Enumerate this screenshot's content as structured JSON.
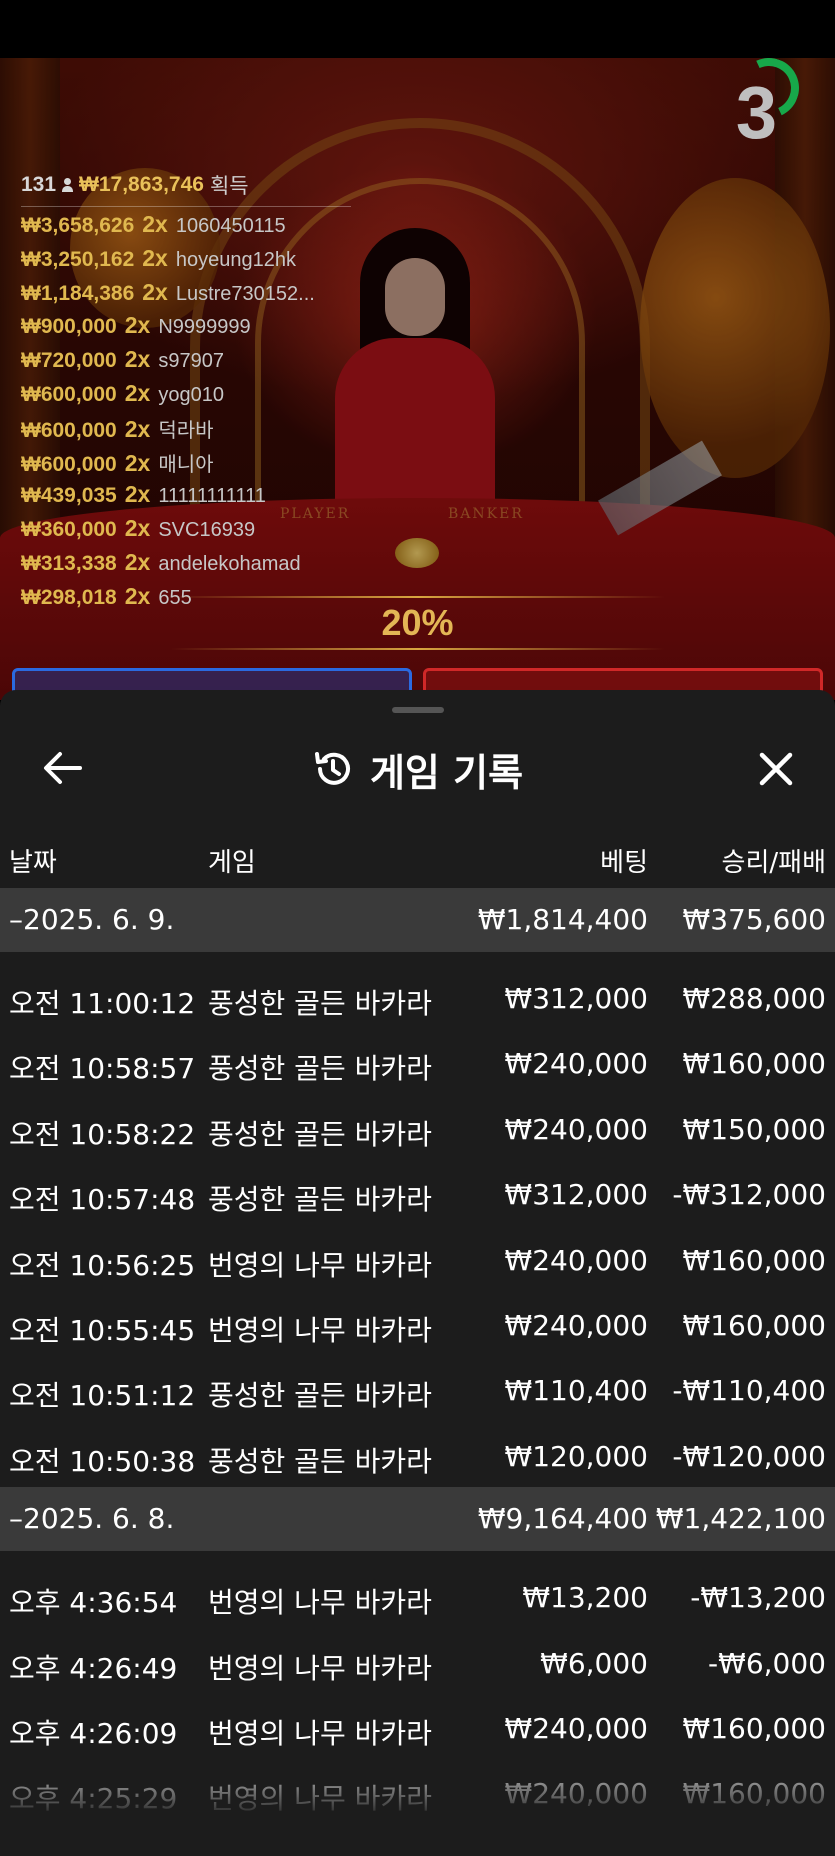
{
  "live_game": {
    "round_counter": "3",
    "winners_header": {
      "players": "131",
      "total": "₩17,863,746",
      "label": "획득"
    },
    "winners": [
      {
        "amount": "₩3,658,626",
        "multiplier": "2x",
        "name": "1060450115"
      },
      {
        "amount": "₩3,250,162",
        "multiplier": "2x",
        "name": "hoyeung12hk"
      },
      {
        "amount": "₩1,184,386",
        "multiplier": "2x",
        "name": "Lustre730152..."
      },
      {
        "amount": "₩900,000",
        "multiplier": "2x",
        "name": "N9999999"
      },
      {
        "amount": "₩720,000",
        "multiplier": "2x",
        "name": "s97907"
      },
      {
        "amount": "₩600,000",
        "multiplier": "2x",
        "name": "yog010"
      },
      {
        "amount": "₩600,000",
        "multiplier": "2x",
        "name": "덕라바"
      },
      {
        "amount": "₩600,000",
        "multiplier": "2x",
        "name": "매니아"
      },
      {
        "amount": "₩439,035",
        "multiplier": "2x",
        "name": "11111111111"
      },
      {
        "amount": "₩360,000",
        "multiplier": "2x",
        "name": "SVC16939"
      },
      {
        "amount": "₩313,338",
        "multiplier": "2x",
        "name": "andelekohamad"
      },
      {
        "amount": "₩298,018",
        "multiplier": "2x",
        "name": "655"
      }
    ],
    "table_labels": {
      "player": "PLAYER",
      "banker": "BANKER"
    },
    "percentage": "20%"
  },
  "history": {
    "title": "게임 기록",
    "columns": {
      "date": "날짜",
      "game": "게임",
      "bet": "베팅",
      "win_loss": "승리/패배"
    },
    "groups": [
      {
        "date": "–2025. 6. 9.",
        "total_bet": "₩1,814,400",
        "total_result": "₩375,600",
        "rows": [
          {
            "time": "오전 11:00:12",
            "game": "풍성한 골든 바카라",
            "bet": "₩312,000",
            "result": "₩288,000"
          },
          {
            "time": "오전 10:58:57",
            "game": "풍성한 골든 바카라",
            "bet": "₩240,000",
            "result": "₩160,000"
          },
          {
            "time": "오전 10:58:22",
            "game": "풍성한 골든 바카라",
            "bet": "₩240,000",
            "result": "₩150,000"
          },
          {
            "time": "오전 10:57:48",
            "game": "풍성한 골든 바카라",
            "bet": "₩312,000",
            "result": "-₩312,000"
          },
          {
            "time": "오전 10:56:25",
            "game": "번영의 나무 바카라",
            "bet": "₩240,000",
            "result": "₩160,000"
          },
          {
            "time": "오전 10:55:45",
            "game": "번영의 나무 바카라",
            "bet": "₩240,000",
            "result": "₩160,000"
          },
          {
            "time": "오전 10:51:12",
            "game": "풍성한 골든 바카라",
            "bet": "₩110,400",
            "result": "-₩110,400"
          },
          {
            "time": "오전 10:50:38",
            "game": "풍성한 골든 바카라",
            "bet": "₩120,000",
            "result": "-₩120,000"
          }
        ]
      },
      {
        "date": "–2025. 6. 8.",
        "total_bet": "₩9,164,400",
        "total_result": "₩1,422,100",
        "rows": [
          {
            "time": "오후 4:36:54",
            "game": "번영의 나무 바카라",
            "bet": "₩13,200",
            "result": "-₩13,200"
          },
          {
            "time": "오후 4:26:49",
            "game": "번영의 나무 바카라",
            "bet": "₩6,000",
            "result": "-₩6,000"
          },
          {
            "time": "오후 4:26:09",
            "game": "번영의 나무 바카라",
            "bet": "₩240,000",
            "result": "₩160,000"
          },
          {
            "time": "오후 4:25:29",
            "game": "번영의 나무 바카라",
            "bet": "₩240,000",
            "result": "₩160,000"
          }
        ]
      }
    ]
  }
}
